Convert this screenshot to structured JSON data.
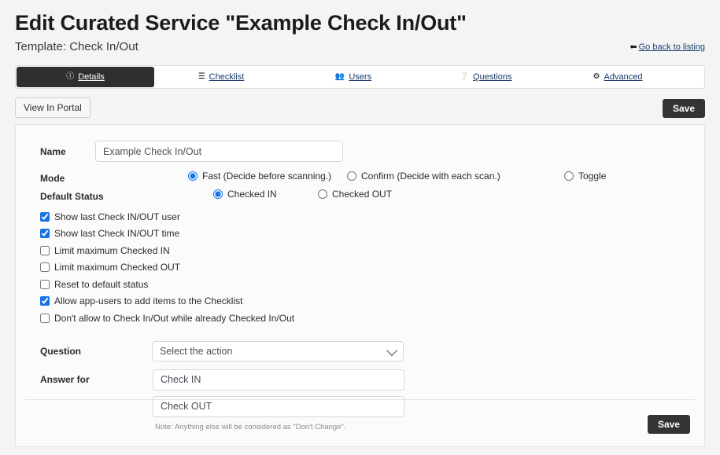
{
  "header": {
    "title": "Edit Curated Service \"Example Check In/Out\"",
    "subtitle": "Template: Check In/Out",
    "back_link": "Go back to listing",
    "back_icon": "arrow-left-icon"
  },
  "tabs": [
    {
      "label": "Details",
      "icon": "info-circle-icon",
      "active": true
    },
    {
      "label": "Checklist",
      "icon": "list-icon",
      "active": false
    },
    {
      "label": "Users",
      "icon": "users-icon",
      "active": false
    },
    {
      "label": "Questions",
      "icon": "question-circle-icon",
      "active": false
    },
    {
      "label": "Advanced",
      "icon": "cogs-icon",
      "active": false
    }
  ],
  "toolbar": {
    "view_in_portal": "View In Portal",
    "save_label": "Save"
  },
  "form": {
    "name": {
      "label": "Name",
      "value": "Example Check In/Out",
      "placeholder": "Name"
    },
    "mode": {
      "label": "Mode",
      "options": [
        {
          "label": "Fast (Decide before scanning.)",
          "selected": true
        },
        {
          "label": "Confirm (Decide with each scan.)",
          "selected": false
        },
        {
          "label": "Toggle",
          "selected": false
        }
      ]
    },
    "default_status": {
      "label": "Default Status",
      "options": [
        {
          "label": "Checked IN",
          "selected": true
        },
        {
          "label": "Checked OUT",
          "selected": false
        }
      ]
    },
    "checkboxes": [
      {
        "label": "Show last Check IN/OUT user",
        "checked": true
      },
      {
        "label": "Show last Check IN/OUT time",
        "checked": true
      },
      {
        "label": "Limit maximum Checked IN",
        "checked": false
      },
      {
        "label": "Limit maximum Checked OUT",
        "checked": false
      },
      {
        "label": "Reset to default status",
        "checked": false
      },
      {
        "label": "Allow app-users to add items to the Checklist",
        "checked": true
      },
      {
        "label": "Don't allow to Check In/Out while already Checked In/Out",
        "checked": false
      }
    ],
    "question": {
      "label": "Question",
      "selected_option": "Select the action",
      "options": [
        "Select the action"
      ]
    },
    "answer": {
      "label": "Answer for",
      "check_in_value": "Check IN",
      "check_out_value": "Check OUT",
      "note": "Note: Anything else will be considered as \"Don't Change\"."
    },
    "save_label": "Save"
  },
  "colors": {
    "accent": "#1573e6",
    "dark_button": "#333333",
    "link": "#16396b",
    "page_background": "#f4f4f4",
    "card_background": "#fbfbfb"
  }
}
